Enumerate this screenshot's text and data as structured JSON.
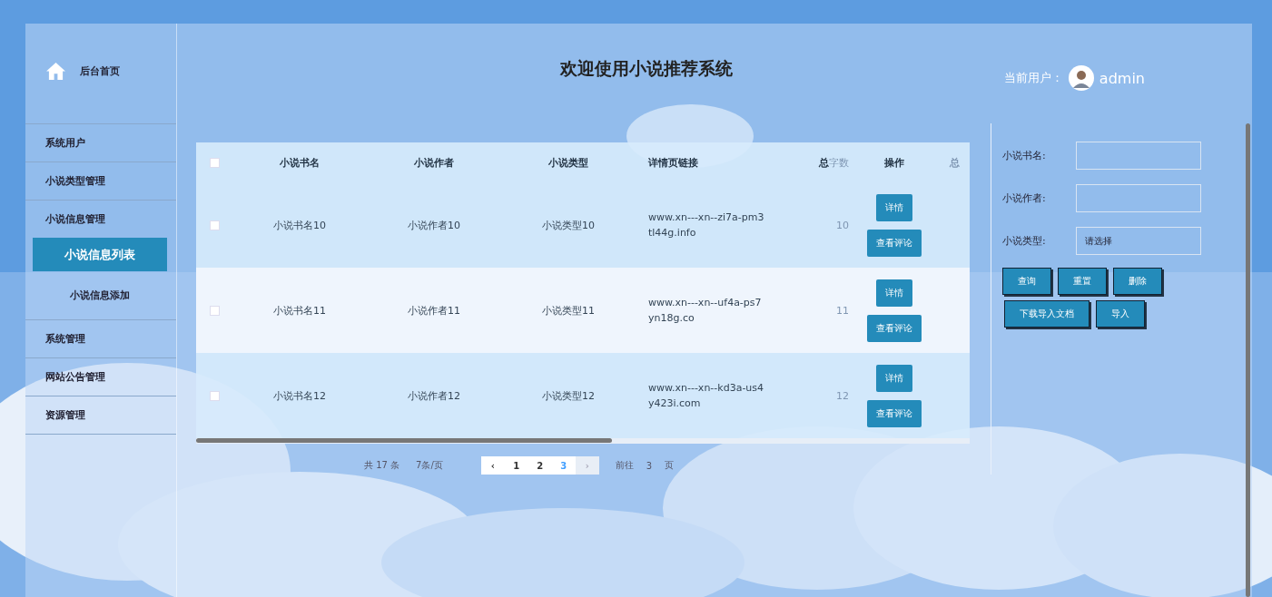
{
  "sidebar": {
    "home": "后台首页",
    "items": [
      {
        "label": "系统用户"
      },
      {
        "label": "小说类型管理"
      },
      {
        "label": "小说信息管理",
        "children": [
          {
            "label": "小说信息列表",
            "selected": true
          },
          {
            "label": "小说信息添加",
            "selected": false
          }
        ]
      },
      {
        "label": "系统管理"
      },
      {
        "label": "网站公告管理"
      },
      {
        "label": "资源管理"
      }
    ]
  },
  "header": {
    "title": "欢迎使用小说推荐系统",
    "user_label": "当前用户：",
    "user_name": "admin"
  },
  "table": {
    "all_checked": false,
    "columns": [
      "小说书名",
      "小说作者",
      "小说类型",
      "详情页链接",
      "总",
      "字数",
      "操作",
      "总"
    ],
    "rows": [
      {
        "checked": false,
        "name": "小说书名10",
        "author": "小说作者10",
        "type": "小说类型10",
        "link": "www.xn---xn--zi7a-pm3tl44g.info",
        "words": "10",
        "actions": [
          "详情",
          "查看评论"
        ]
      },
      {
        "checked": false,
        "name": "小说书名11",
        "author": "小说作者11",
        "type": "小说类型11",
        "link": "www.xn---xn--uf4a-ps7yn18g.co",
        "words": "11",
        "actions": [
          "详情",
          "查看评论"
        ]
      },
      {
        "checked": false,
        "name": "小说书名12",
        "author": "小说作者12",
        "type": "小说类型12",
        "link": "www.xn---xn--kd3a-us4y423i.com",
        "words": "12",
        "actions": [
          "详情",
          "查看评论"
        ]
      }
    ]
  },
  "pagination": {
    "total": "共 17 条",
    "page_size": "7条/页",
    "prev": "‹",
    "pages": [
      {
        "label": "1",
        "selected": false
      },
      {
        "label": "2",
        "selected": false
      },
      {
        "label": "3",
        "selected": true
      }
    ],
    "next": "›",
    "goto_label": "前往",
    "goto_value": "3",
    "goto_unit": "页"
  },
  "search": {
    "fields": [
      {
        "label": "小说书名:",
        "kind": "text"
      },
      {
        "label": "小说作者:",
        "kind": "text"
      },
      {
        "label": "小说类型:",
        "kind": "select",
        "placeholder": "请选择"
      }
    ],
    "buttons": [
      [
        "查询",
        "重置",
        "删除"
      ],
      [
        "下载导入文档",
        "导入"
      ]
    ]
  }
}
